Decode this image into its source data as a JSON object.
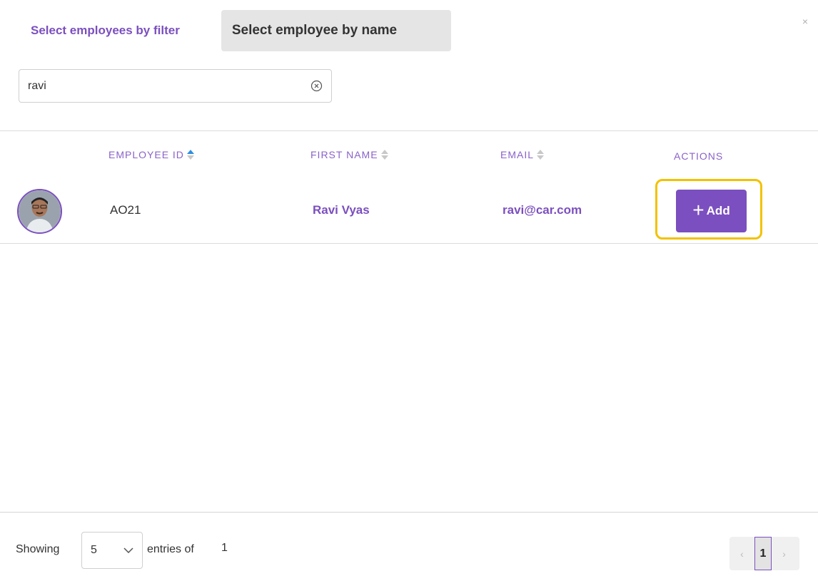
{
  "tabs": {
    "filter_label": "Select employees by filter",
    "name_label": "Select employee by name"
  },
  "close_glyph": "×",
  "search": {
    "value": "ravi",
    "placeholder": ""
  },
  "table": {
    "headers": {
      "employee_id": "EMPLOYEE ID",
      "first_name": "FIRST NAME",
      "email": "EMAIL",
      "actions": "ACTIONS"
    },
    "rows": [
      {
        "employee_id": "AO21",
        "first_name": "Ravi Vyas",
        "email": "ravi@car.com",
        "action_label": "Add",
        "action_icon": "+"
      }
    ]
  },
  "footer": {
    "showing_label": "Showing",
    "page_size": "5",
    "entries_label": "entries of",
    "total": "1",
    "current_page": "1",
    "prev_glyph": "‹",
    "next_glyph": "›"
  },
  "colors": {
    "accent": "#7b4fbf",
    "highlight": "#f2c200",
    "sort_active": "#2f8ee0"
  }
}
